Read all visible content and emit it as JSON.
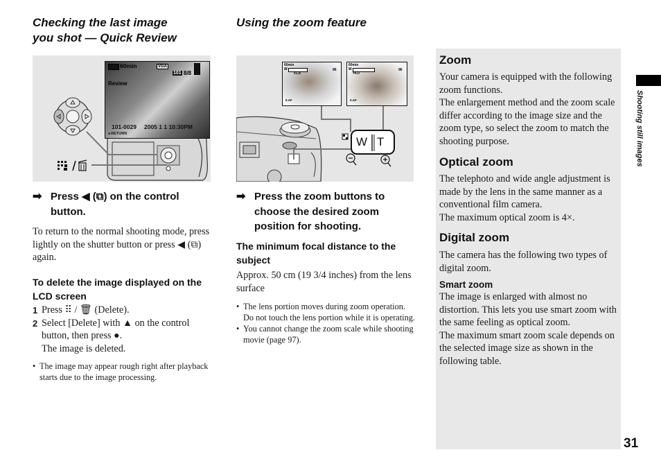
{
  "left": {
    "title_line1": "Checking the last image",
    "title_line2": "you shot — Quick Review",
    "figure": {
      "lcd_battery": "60min",
      "lcd_image_size": "VGA",
      "lcd_folder": "101",
      "lcd_count": "8/8",
      "lcd_mode": "Review",
      "lcd_file": "101-0029",
      "lcd_datetime": "2005  1  1 10:30PM",
      "lcd_return": "◂ RETURN",
      "delete_label": "/ "
    },
    "step_arrow": "➡",
    "step_text": "Press ◀ (⧉) on the control button.",
    "body": "To return to the normal shooting mode, press lightly on the shutter button or press ◀ (⧉) again.",
    "delete_heading": "To delete the image displayed on the LCD screen",
    "steps": [
      {
        "n": "1",
        "text": "Press ⠿ / 🗑 (Delete)."
      },
      {
        "n": "2",
        "text": "Select [Delete] with ▲ on the control button, then press ●."
      },
      {
        "n": "",
        "text": "The image is deleted."
      }
    ],
    "notes": [
      "The image may appear rough right after playback starts due to the image processing."
    ]
  },
  "middle": {
    "title": "Using the zoom feature",
    "figure": {
      "lcd_battery": "60min",
      "lcd_w": "W",
      "lcd_t": "T",
      "lcd_zoom_left": "x1.8",
      "lcd_zoom_right": "×4.0",
      "lcd_count": "96",
      "lcd_af": "0.AF",
      "button_w": "W",
      "button_t": "T"
    },
    "step_arrow": "➡",
    "step_text": "Press the zoom buttons to choose the desired zoom position for shooting.",
    "subhead": "The minimum focal distance to the subject",
    "body": "Approx. 50 cm (19 3/4 inches) from the lens surface",
    "notes": [
      "The lens portion moves during zoom operation. Do not touch the lens portion while it is operating.",
      "You cannot change the zoom scale while shooting movie (page 97)."
    ]
  },
  "right": {
    "zoom_heading": "Zoom",
    "zoom_body1": "Your camera is equipped with the following zoom functions.",
    "zoom_body2": "The enlargement method and the zoom scale differ according to the image size and the zoom type, so select the zoom to match the shooting purpose.",
    "optical_heading": "Optical zoom",
    "optical_body1": "The telephoto and wide angle adjustment is made by the lens in the same manner as a conventional film camera.",
    "optical_body2": "The maximum optical zoom is 4×.",
    "digital_heading": "Digital zoom",
    "digital_body": "The camera has the following two types of digital zoom.",
    "smart_heading": "Smart zoom",
    "smart_body1": "The image is enlarged with almost no distortion. This lets you use smart zoom with the same feeling as optical zoom.",
    "smart_body2": "The maximum smart zoom scale depends on the selected image size as shown in the following table."
  },
  "side_tab": {
    "label": "Shooting still images"
  },
  "page_number": "31"
}
